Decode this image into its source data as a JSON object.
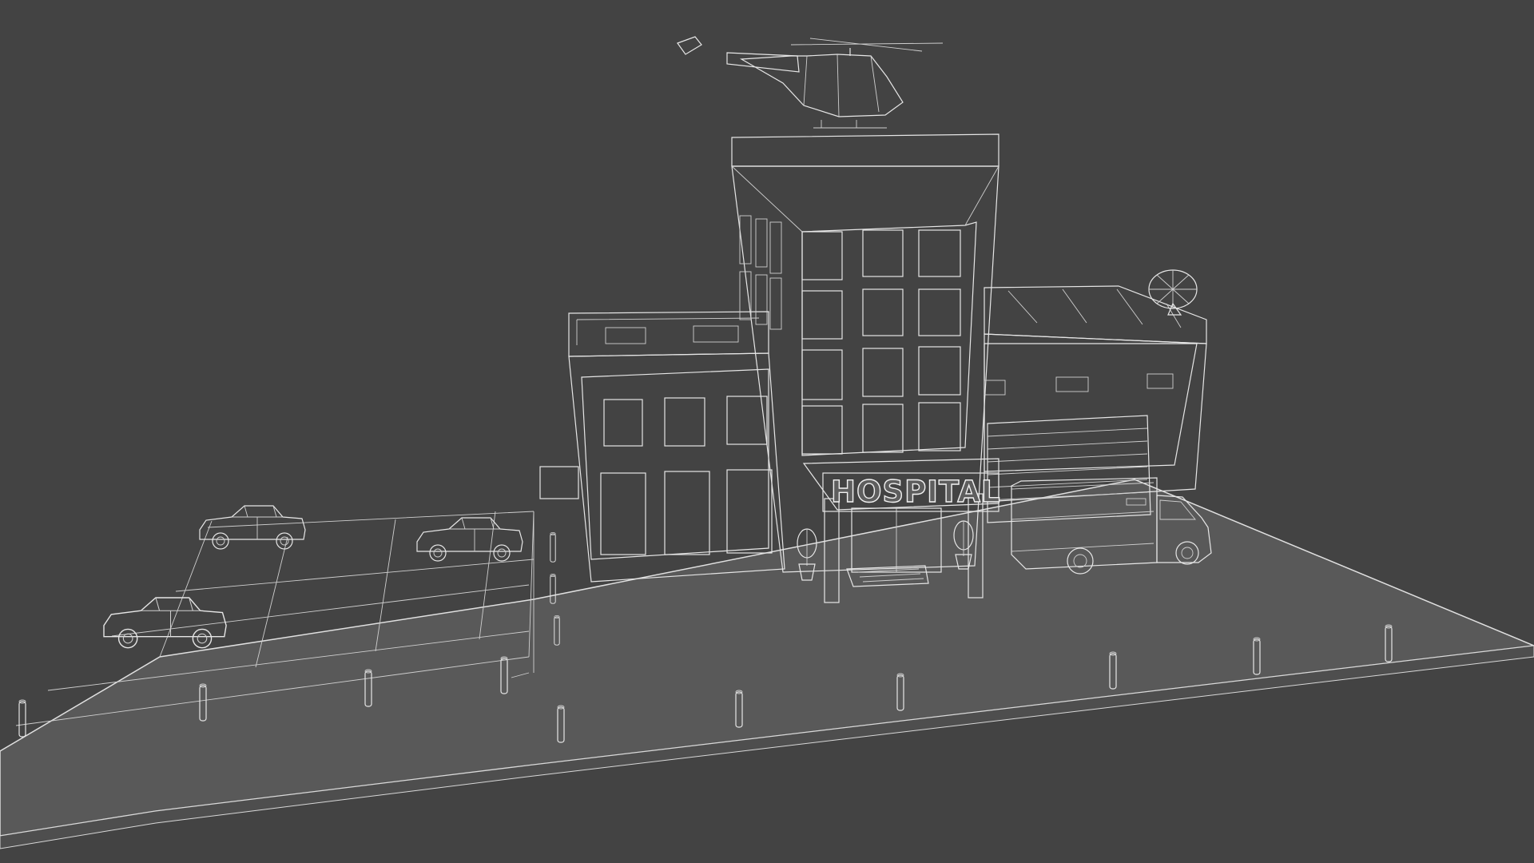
{
  "scene": {
    "background_color": "#434343",
    "wire_color": "#e6e6e6",
    "sign_text": "HOSPITAL",
    "objects": [
      "helicopter-icon",
      "hospital-building",
      "ambulance-icon",
      "car-icon",
      "satellite-dish-icon",
      "potted-tree-icon",
      "bollard-icon",
      "parking-lot"
    ]
  }
}
